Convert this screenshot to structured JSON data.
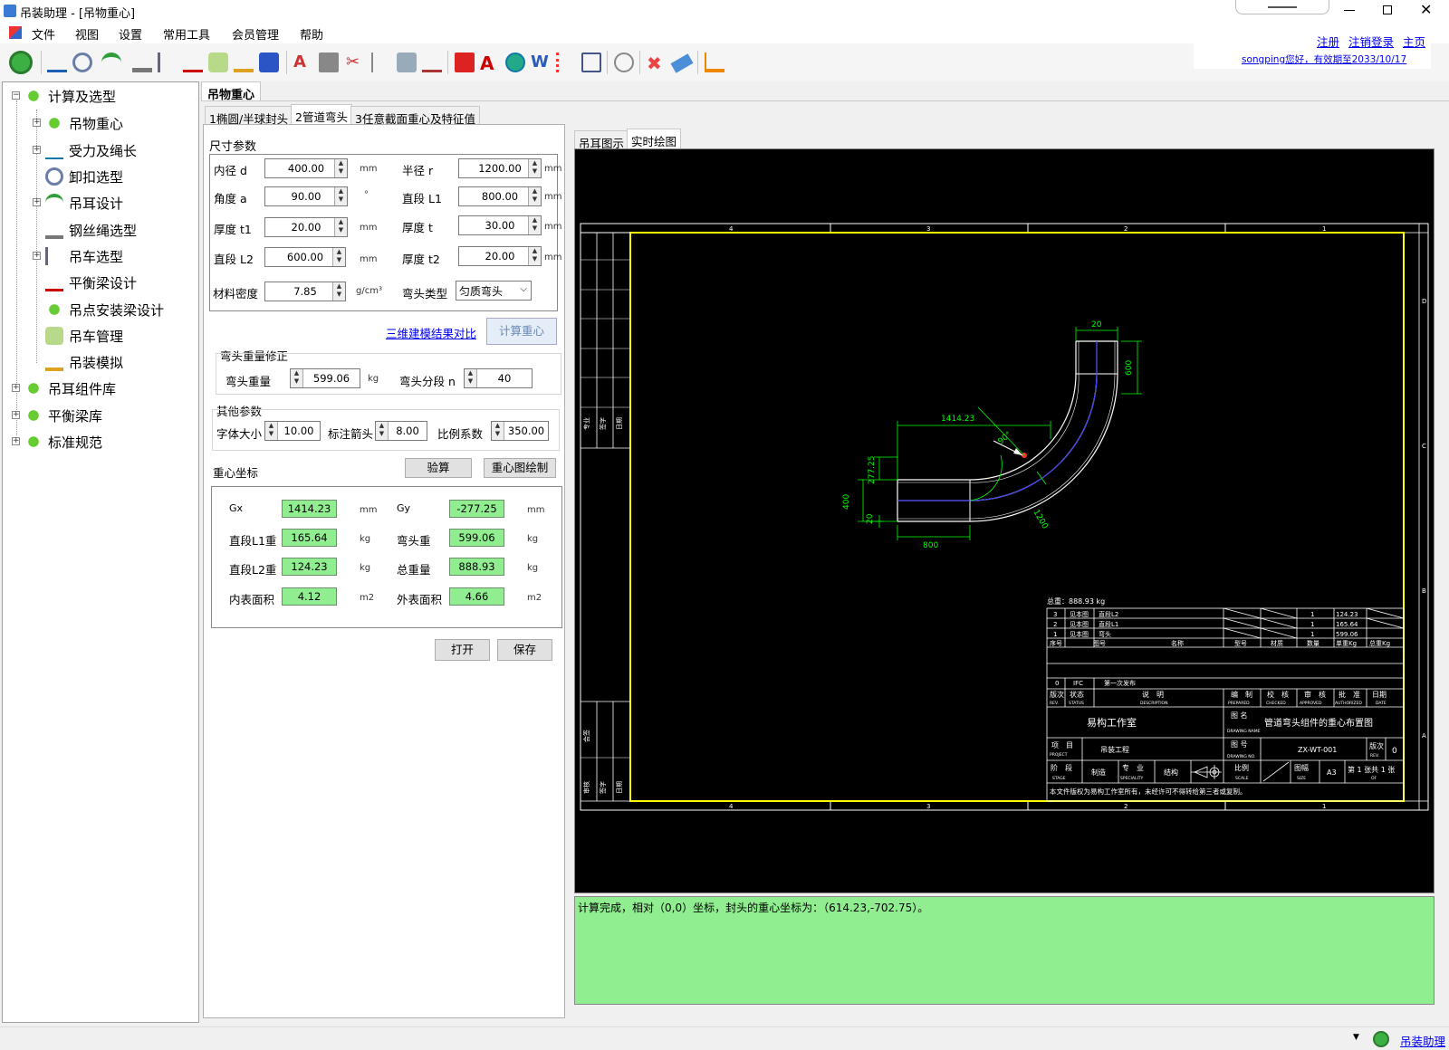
{
  "window": {
    "title": "吊装助理 - [吊物重心]"
  },
  "menu": [
    "文件",
    "视图",
    "设置",
    "常用工具",
    "会员管理",
    "帮助"
  ],
  "user": {
    "register": "注册",
    "logout": "注销登录",
    "home": "主页",
    "greeting": "songping您好，有效期至2033/10/17"
  },
  "tree": {
    "root": "计算及选型",
    "children": [
      "吊物重心",
      "受力及绳长",
      "卸扣选型",
      "吊耳设计",
      "钢丝绳选型",
      "吊车选型",
      "平衡梁设计",
      "吊点安装梁设计",
      "吊车管理",
      "吊装模拟"
    ],
    "others": [
      "吊耳组件库",
      "平衡梁库",
      "标准规范"
    ]
  },
  "tabs": {
    "main": "吊物重心",
    "sub": [
      "1椭圆/半球封头",
      "2管道弯头",
      "3任意截面重心及特征值"
    ],
    "cad": [
      "吊耳图示",
      "实时绘图"
    ]
  },
  "dims": {
    "title": "尺寸参数",
    "d_label": "内径 d",
    "d": "400.00",
    "d_unit": "mm",
    "r_label": "半径 r",
    "r": "1200.00",
    "r_unit": "mm",
    "a_label": "角度 a",
    "a": "90.00",
    "a_unit": "°",
    "L1_label": "直段 L1",
    "L1": "800.00",
    "L1_unit": "mm",
    "t1_label": "厚度 t1",
    "t1": "20.00",
    "t1_unit": "mm",
    "t_label": "厚度 t",
    "t": "30.00",
    "t_unit": "mm",
    "L2_label": "直段 L2",
    "L2": "600.00",
    "L2_unit": "mm",
    "t2_label": "厚度 t2",
    "t2": "20.00",
    "t2_unit": "mm",
    "rho_label": "材料密度",
    "rho": "7.85",
    "rho_unit": "g/cm³",
    "type_label": "弯头类型",
    "type": "匀质弯头"
  },
  "actions": {
    "compare": "三维建模结果对比",
    "calc": "计算重心"
  },
  "correction": {
    "title": "弯头重量修正",
    "w_label": "弯头重量",
    "w": "599.06",
    "w_unit": "kg",
    "n_label": "弯头分段 n",
    "n": "40"
  },
  "other": {
    "title": "其他参数",
    "font_label": "字体大小",
    "font": "10.00",
    "arrow_label": "标注箭头",
    "arrow": "8.00",
    "scale_label": "比例系数",
    "scale": "350.00"
  },
  "cog": {
    "title": "重心坐标",
    "verify": "验算",
    "draw": "重心图绘制",
    "gx_label": "Gx",
    "gx": "1414.23",
    "gx_unit": "mm",
    "gy_label": "Gy",
    "gy": "-277.25",
    "gy_unit": "mm",
    "l1w_label": "直段L1重",
    "l1w": "165.64",
    "l1w_unit": "kg",
    "bw_label": "弯头重",
    "bw": "599.06",
    "bw_unit": "kg",
    "l2w_label": "直段L2重",
    "l2w": "124.23",
    "l2w_unit": "kg",
    "tw_label": "总重量",
    "tw": "888.93",
    "tw_unit": "kg",
    "ia_label": "内表面积",
    "ia": "4.12",
    "ia_unit": "m2",
    "oa_label": "外表面积",
    "oa": "4.66",
    "oa_unit": "m2"
  },
  "file": {
    "open": "打开",
    "save": "保存"
  },
  "drawing": {
    "dim_20_top": "20",
    "dim_600": "600",
    "dim_1414": "1414.23",
    "dim_90": "90°",
    "dim_277": "277.25",
    "dim_400": "400",
    "dim_20_left": "20",
    "dim_800": "800",
    "dim_1200": "1200",
    "total": "总重：888.93 kg",
    "bom": [
      {
        "no": "3",
        "drw": "见本图",
        "name": "直段L2",
        "qty": "1",
        "w": "124.23"
      },
      {
        "no": "2",
        "drw": "见本图",
        "name": "直段L1",
        "qty": "1",
        "w": "165.64"
      },
      {
        "no": "1",
        "drw": "见本图",
        "name": "弯头",
        "qty": "1",
        "w": "599.06"
      }
    ],
    "bom_head": [
      "序号",
      "图号",
      "名称",
      "型号",
      "材质",
      "数量",
      "单重Kg",
      "总重Kg"
    ],
    "rev": {
      "no": "0",
      "status": "IFC",
      "desc": "第一次发布"
    },
    "rev_head": [
      "版次",
      "状态",
      "说　明",
      "编　制",
      "校　核",
      "审　核",
      "批　准",
      "日期"
    ],
    "rev_head_en": [
      "REV.",
      "STATUS",
      "DESCRIPTION",
      "PREPARED",
      "CHECKED",
      "APPROVED",
      "AUTHORIZED",
      "DATE"
    ],
    "company": "易构工作室",
    "title_lbl": "图 名",
    "title_lbl_en": "DRAWING NAME",
    "title": "管道弯头组件的重心布置图",
    "project_lbl": "项　目",
    "project_lbl_en": "PROJECT",
    "project": "吊装工程",
    "dno_lbl": "图 号",
    "dno_lbl_en": "DRAWING NO.",
    "dno": "ZX-WT-001",
    "ver_lbl": "版次",
    "ver_lbl_en": "REV.",
    "ver": "0",
    "stage_lbl": "阶　段",
    "stage_lbl_en": "STAGE",
    "stage": "制造",
    "spec_lbl": "专　业",
    "spec_lbl_en": "SPECIALITY",
    "spec": "结构",
    "scale_lbl": "比例",
    "scale_lbl_en": "SCALE",
    "size_lbl": "图幅",
    "size_lbl_en": "SIZE",
    "size": "A3",
    "sheet": "第 1 张共 1 张",
    "sheet_en": "OF",
    "copyright": "本文件版权为易构工作室所有，未经许可不得转给第三者或复制。",
    "side_top": [
      "专业",
      "签字",
      "日期"
    ],
    "side_bottom_a": "会签",
    "side_bottom_b": [
      "审核",
      "签字",
      "日期"
    ],
    "top_nums": [
      "4",
      "3",
      "2",
      "1"
    ],
    "right_letters": [
      "D",
      "C",
      "B",
      "A"
    ]
  },
  "log": "计算完成，相对（0,0）坐标，封头的重心坐标为：（614.23,-702.75）。",
  "status": {
    "app": "吊装助理"
  }
}
